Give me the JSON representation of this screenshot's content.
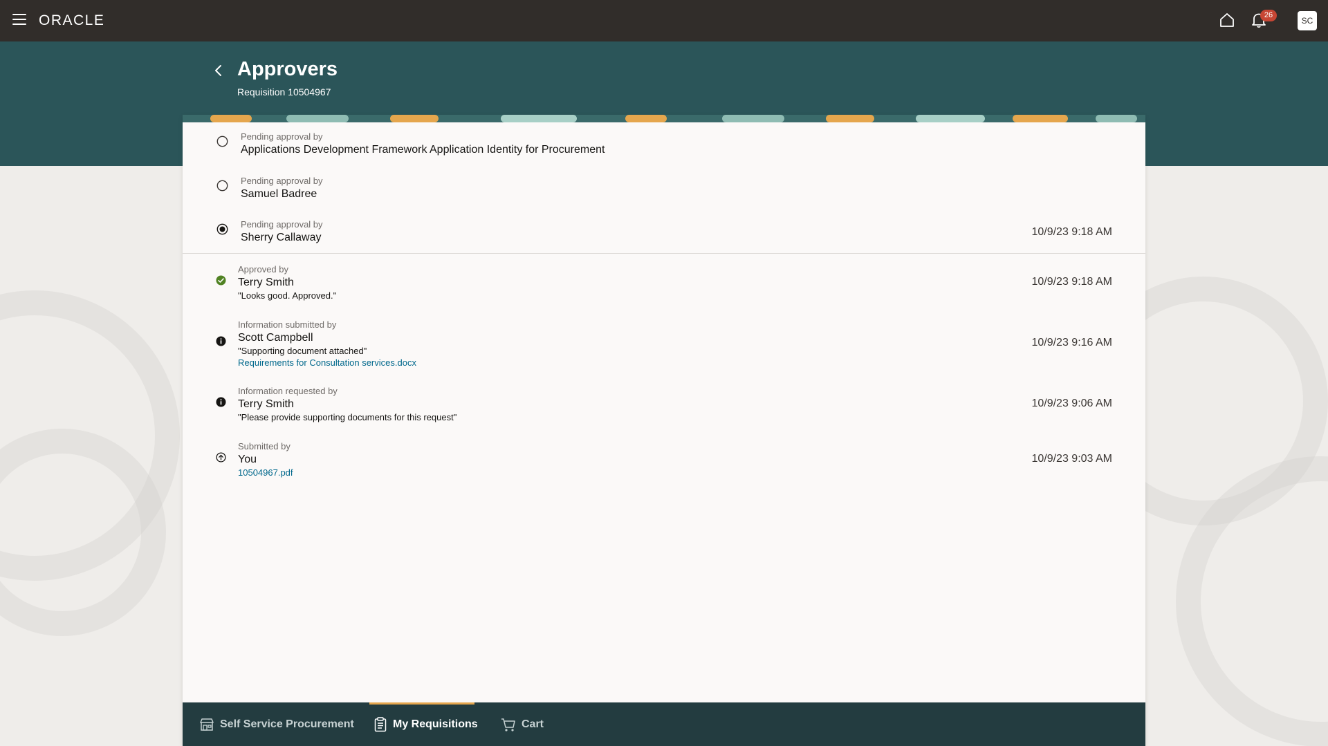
{
  "header": {
    "logo": "ORACLE",
    "notification_count": "26",
    "avatar_initials": "SC"
  },
  "page": {
    "title": "Approvers",
    "subtitle": "Requisition 10504967"
  },
  "timeline": {
    "pending": [
      {
        "label": "Pending approval by",
        "name": "Applications Development Framework Application Identity for Procurement",
        "time": "",
        "icon": "empty-circle-icon"
      },
      {
        "label": "Pending approval by",
        "name": "Samuel Badree",
        "time": "",
        "icon": "empty-circle-icon"
      },
      {
        "label": "Pending approval by",
        "name": "Sherry Callaway",
        "time": "10/9/23 9:18 AM",
        "icon": "current-step-icon"
      }
    ],
    "history": [
      {
        "label": "Approved by",
        "name": "Terry Smith",
        "comment": "\"Looks good. Approved.\"",
        "time": "10/9/23 9:18 AM",
        "icon": "check-circle-icon"
      },
      {
        "label": "Information submitted by",
        "name": "Scott Campbell",
        "comment": "\"Supporting document attached\"",
        "attachment": "Requirements for Consultation services.docx",
        "time": "10/9/23 9:16 AM",
        "icon": "info-icon"
      },
      {
        "label": "Information requested by",
        "name": "Terry Smith",
        "comment": "\"Please provide supporting documents for this request\"",
        "time": "10/9/23 9:06 AM",
        "icon": "info-icon"
      },
      {
        "label": "Submitted by",
        "name": "You",
        "attachment": "10504967.pdf",
        "time": "10/9/23 9:03 AM",
        "icon": "submit-icon"
      }
    ]
  },
  "bottom_nav": {
    "items": [
      {
        "label": "Self Service Procurement",
        "icon": "store-icon"
      },
      {
        "label": "My Requisitions",
        "icon": "clipboard-icon",
        "active": true
      },
      {
        "label": "Cart",
        "icon": "cart-icon"
      }
    ]
  },
  "colors": {
    "topbar": "#312d2a",
    "header_teal": "#2b5559",
    "bottom_nav": "#233c40",
    "accent": "#e5a64d",
    "link": "#00688c",
    "badge": "#c74634",
    "success": "#508223"
  }
}
